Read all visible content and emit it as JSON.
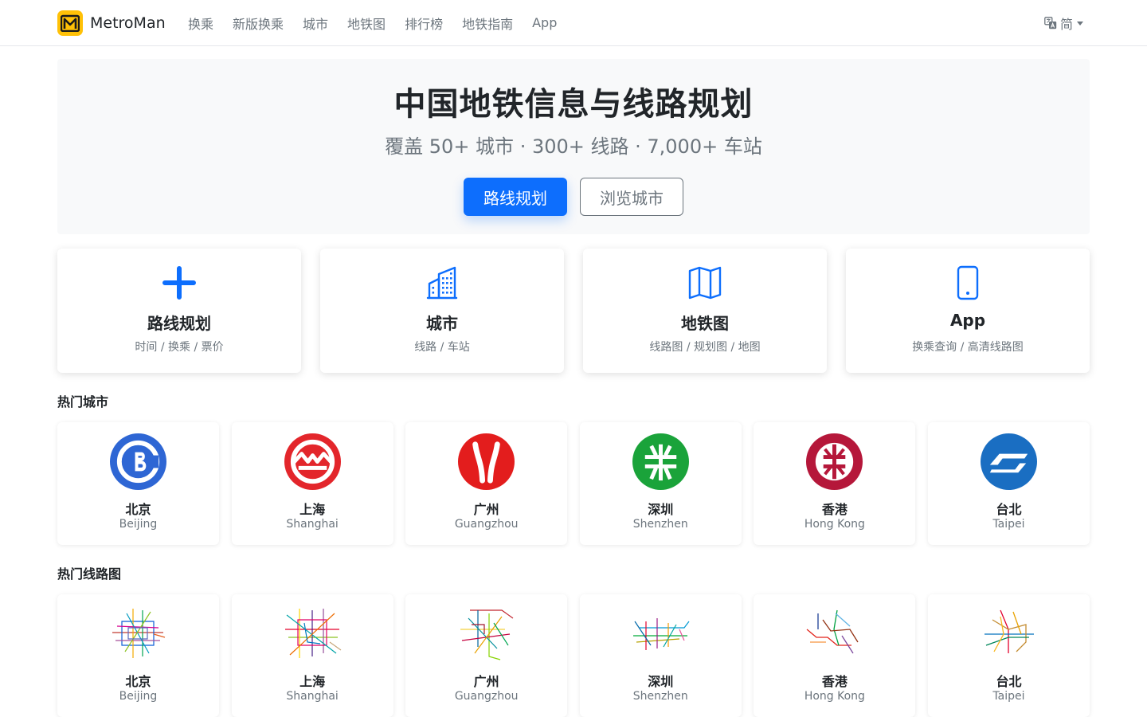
{
  "navbar": {
    "brand": "MetroMan",
    "links": [
      "换乘",
      "新版换乘",
      "城市",
      "地铁图",
      "排行榜",
      "地铁指南",
      "App"
    ],
    "language": "简"
  },
  "hero": {
    "title": "中国地铁信息与线路规划",
    "subtitle": "覆盖 50+ 城市 · 300+ 线路 · 7,000+ 车站",
    "primary_button": "路线规划",
    "secondary_button": "浏览城市"
  },
  "features": [
    {
      "title": "路线规划",
      "subtitle": "时间 / 换乘 / 票价",
      "icon": "plus-icon"
    },
    {
      "title": "城市",
      "subtitle": "线路 / 车站",
      "icon": "buildings-icon"
    },
    {
      "title": "地铁图",
      "subtitle": "线路图 / 规划图 / 地图",
      "icon": "map-icon"
    },
    {
      "title": "App",
      "subtitle": "换乘查询 / 高清线路图",
      "icon": "phone-icon"
    }
  ],
  "hot_cities": {
    "heading": "热门城市",
    "items": [
      {
        "name": "北京",
        "en": "Beijing",
        "color": "#2e66d4"
      },
      {
        "name": "上海",
        "en": "Shanghai",
        "color": "#e3262b"
      },
      {
        "name": "广州",
        "en": "Guangzhou",
        "color": "#e31d1d"
      },
      {
        "name": "深圳",
        "en": "Shenzhen",
        "color": "#1aa33a"
      },
      {
        "name": "香港",
        "en": "Hong Kong",
        "color": "#b5173a"
      },
      {
        "name": "台北",
        "en": "Taipei",
        "color": "#1a6ec2"
      }
    ]
  },
  "hot_maps": {
    "heading": "热门线路图",
    "items": [
      {
        "name": "北京",
        "en": "Beijing"
      },
      {
        "name": "上海",
        "en": "Shanghai"
      },
      {
        "name": "广州",
        "en": "Guangzhou"
      },
      {
        "name": "深圳",
        "en": "Shenzhen"
      },
      {
        "name": "香港",
        "en": "Hong Kong"
      },
      {
        "name": "台北",
        "en": "Taipei"
      }
    ]
  },
  "colors": {
    "primary": "#0d6efd",
    "brand": "#ffc107",
    "muted": "#6c757d"
  }
}
